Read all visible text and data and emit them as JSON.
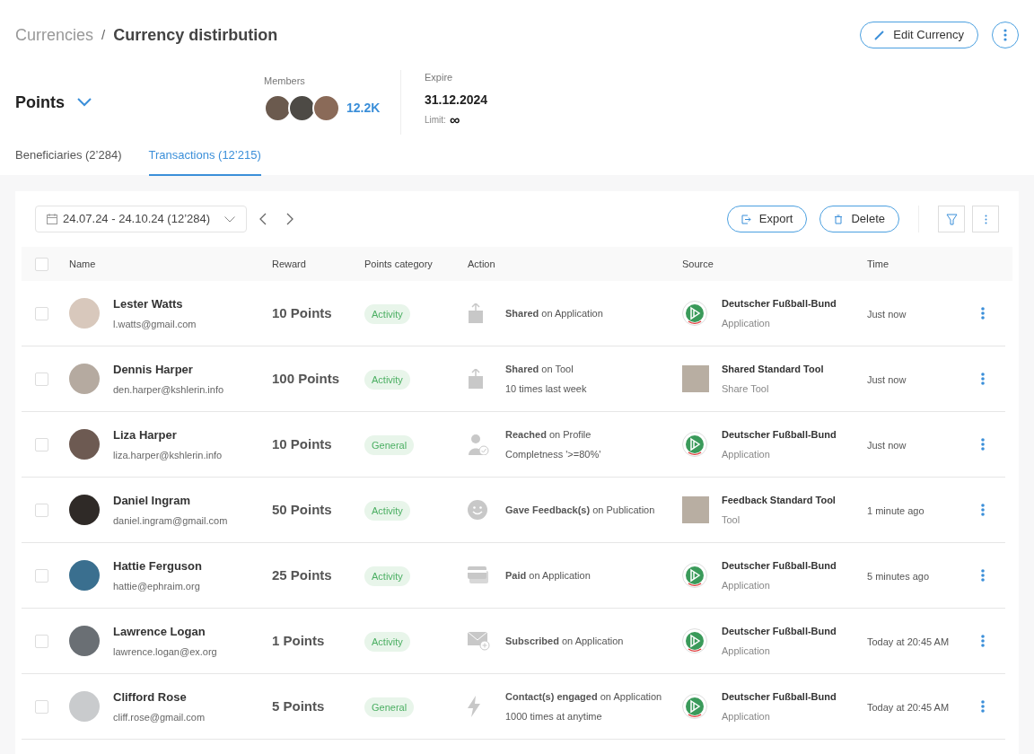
{
  "breadcrumb": {
    "parent": "Currencies",
    "separator": "/",
    "current": "Currency distirbution"
  },
  "header_actions": {
    "edit_button": "Edit Currency"
  },
  "currency": {
    "name": "Points"
  },
  "members": {
    "label": "Members",
    "count": "12.2K"
  },
  "expire": {
    "label": "Expire",
    "date": "31.12.2024",
    "limit_label": "Limit:",
    "limit_value": "∞"
  },
  "tabs": [
    {
      "label": "Beneficiaries (2’284)",
      "selected": false
    },
    {
      "label": "Transactions (12’215)",
      "selected": true
    }
  ],
  "toolbar": {
    "date_range": "24.07.24 - 24.10.24 (12’284)",
    "export": "Export",
    "delete": "Delete"
  },
  "table": {
    "all_selected": false,
    "columns": [
      "Name",
      "Reward",
      "Points category",
      "Action",
      "Source",
      "Time"
    ],
    "rows": [
      {
        "checked": false,
        "name": "Lester Watts",
        "email": "l.watts@gmail.com",
        "reward": "10 Points",
        "category": "Activity",
        "action": {
          "kind": "share",
          "text": "**Shared** on Application"
        },
        "source": {
          "kind": "logo",
          "name": "Deutscher Fußball-Bund",
          "type": "Application"
        },
        "time": "Just now"
      },
      {
        "checked": false,
        "name": "Dennis Harper",
        "email": "den.harper@kshlerin.info",
        "reward": "100 Points",
        "category": "Activity",
        "action": {
          "kind": "share",
          "text": "**Shared** on Tool",
          "detail": "10 times last week"
        },
        "source": {
          "kind": "photo",
          "name": "Shared Standard Tool",
          "type": "Share Tool"
        },
        "time": "Just now"
      },
      {
        "checked": false,
        "name": "Liza Harper",
        "email": "liza.harper@kshlerin.info",
        "reward": "10 Points",
        "category": "General",
        "action": {
          "kind": "person",
          "text": "**Reached** on Profile",
          "detail": "Completness '>=80%'"
        },
        "source": {
          "kind": "logo",
          "name": "Deutscher Fußball-Bund",
          "type": "Application"
        },
        "time": "Just now"
      },
      {
        "checked": false,
        "name": "Daniel Ingram",
        "email": "daniel.ingram@gmail.com",
        "reward": "50 Points",
        "category": "Activity",
        "action": {
          "kind": "smiley",
          "text": "**Gave Feedback(s)** on Publication"
        },
        "source": {
          "kind": "photo",
          "name": "Feedback Standard Tool",
          "type": "Tool"
        },
        "time": "1 minute ago"
      },
      {
        "checked": false,
        "name": "Hattie Ferguson",
        "email": "hattie@ephraim.org",
        "reward": "25 Points",
        "category": "Activity",
        "action": {
          "kind": "card",
          "text": "**Paid** on Application"
        },
        "source": {
          "kind": "logo",
          "name": "Deutscher Fußball-Bund",
          "type": "Application"
        },
        "time": "5 minutes ago"
      },
      {
        "checked": false,
        "name": "Lawrence Logan",
        "email": "lawrence.logan@ex.org",
        "reward": "1 Points",
        "category": "Activity",
        "action": {
          "kind": "mail",
          "text": "**Subscribed** on Application"
        },
        "source": {
          "kind": "logo",
          "name": "Deutscher Fußball-Bund",
          "type": "Application"
        },
        "time": "Today at 20:45 AM"
      },
      {
        "checked": false,
        "name": "Clifford Rose",
        "email": "cliff.rose@gmail.com",
        "reward": "5 Points",
        "category": "General",
        "action": {
          "kind": "bolt",
          "text": "**Contact(s) engaged** on Application",
          "detail": "1000 times at anytime"
        },
        "source": {
          "kind": "logo",
          "name": "Deutscher Fußball-Bund",
          "type": "Application"
        },
        "time": "Today at 20:45 AM"
      }
    ]
  }
}
